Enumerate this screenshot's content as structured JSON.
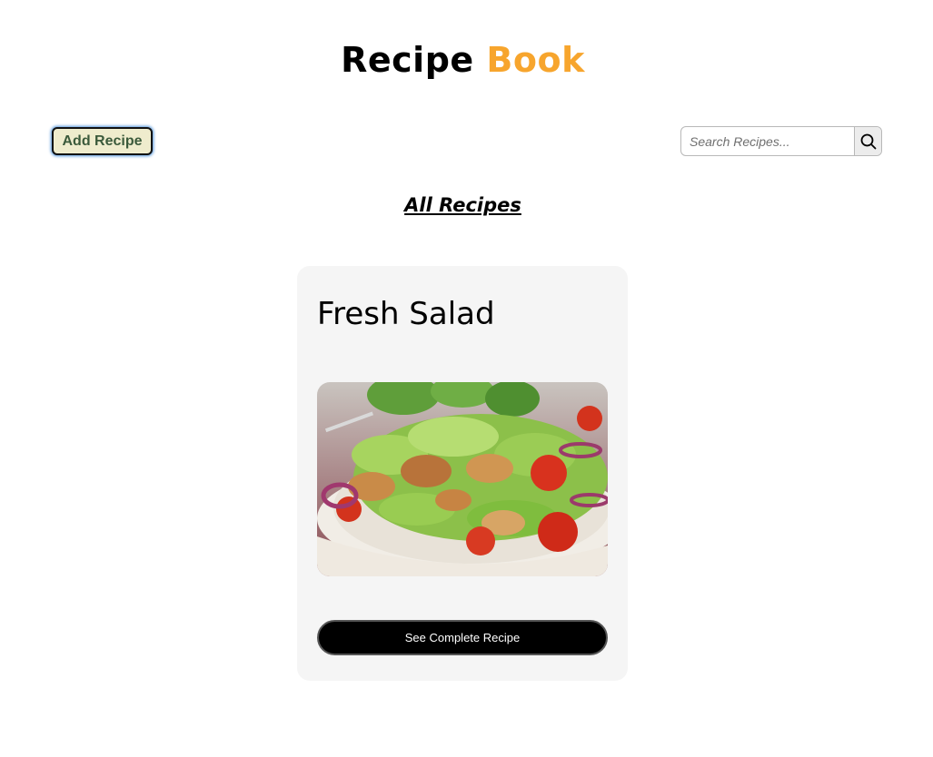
{
  "header": {
    "title_main": "Recipe",
    "title_accent": "Book",
    "accent_color": "#f7a52d"
  },
  "toolbar": {
    "add_label": "Add Recipe",
    "search_placeholder": "Search Recipes...",
    "search_value": "",
    "search_icon": "search-icon"
  },
  "section": {
    "heading": "All Recipes"
  },
  "recipes": [
    {
      "title": "Fresh Salad",
      "image": "salad-photo",
      "button_label": "See Complete Recipe"
    }
  ]
}
